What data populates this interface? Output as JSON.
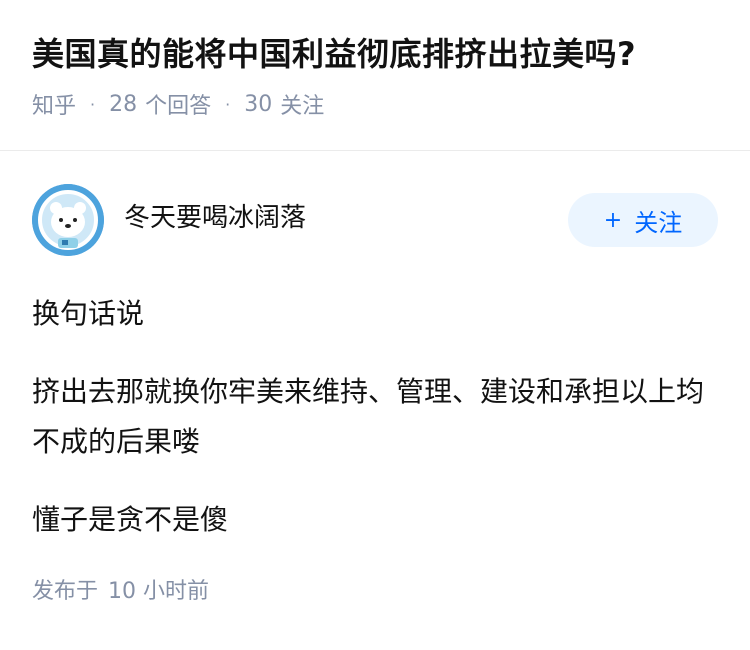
{
  "question": {
    "title": "美国真的能将中国利益彻底排挤出拉美吗?",
    "source": "知乎",
    "answers_count": "28",
    "answers_label": "个回答",
    "followers_count": "30",
    "followers_label": "关注"
  },
  "answer": {
    "author": {
      "name": "冬天要喝冰阔落",
      "avatar_icon": "polar-bear-astronaut-avatar",
      "follow_label": "关注",
      "follow_icon": "plus-icon"
    },
    "paragraphs": [
      "换句话说",
      "挤出去那就换你牢美来维持、管理、建设和承担以上均不成的后果喽",
      "懂子是贪不是傻"
    ],
    "published_prefix": "发布于",
    "published_time": "10 小时前"
  },
  "colors": {
    "meta_gray": "#8590a6",
    "accent_blue": "#0066ff",
    "button_bg": "#ebf5ff"
  }
}
